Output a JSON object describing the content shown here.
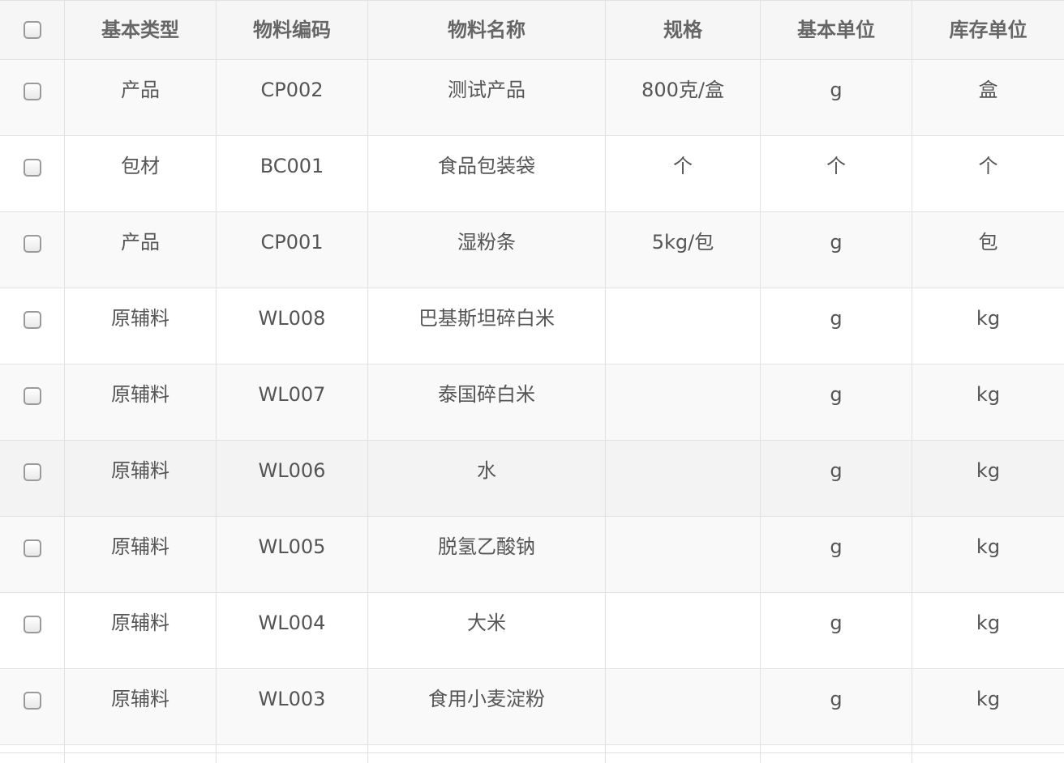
{
  "table": {
    "headers": {
      "basic_type": "基本类型",
      "material_code": "物料编码",
      "material_name": "物料名称",
      "spec": "规格",
      "base_unit": "基本单位",
      "stock_unit": "库存单位"
    },
    "rows": [
      {
        "basic_type": "产品",
        "material_code": "CP002",
        "material_name": "测试产品",
        "spec": "800克/盒",
        "base_unit": "g",
        "stock_unit": "盒"
      },
      {
        "basic_type": "包材",
        "material_code": "BC001",
        "material_name": "食品包装袋",
        "spec": "个",
        "base_unit": "个",
        "stock_unit": "个"
      },
      {
        "basic_type": "产品",
        "material_code": "CP001",
        "material_name": "湿粉条",
        "spec": "5kg/包",
        "base_unit": "g",
        "stock_unit": "包"
      },
      {
        "basic_type": "原辅料",
        "material_code": "WL008",
        "material_name": "巴基斯坦碎白米",
        "spec": "",
        "base_unit": "g",
        "stock_unit": "kg"
      },
      {
        "basic_type": "原辅料",
        "material_code": "WL007",
        "material_name": "泰国碎白米",
        "spec": "",
        "base_unit": "g",
        "stock_unit": "kg"
      },
      {
        "basic_type": "原辅料",
        "material_code": "WL006",
        "material_name": "水",
        "spec": "",
        "base_unit": "g",
        "stock_unit": "kg"
      },
      {
        "basic_type": "原辅料",
        "material_code": "WL005",
        "material_name": "脱氢乙酸钠",
        "spec": "",
        "base_unit": "g",
        "stock_unit": "kg"
      },
      {
        "basic_type": "原辅料",
        "material_code": "WL004",
        "material_name": "大米",
        "spec": "",
        "base_unit": "g",
        "stock_unit": "kg"
      },
      {
        "basic_type": "原辅料",
        "material_code": "WL003",
        "material_name": "食用小麦淀粉",
        "spec": "",
        "base_unit": "g",
        "stock_unit": "kg"
      }
    ]
  }
}
